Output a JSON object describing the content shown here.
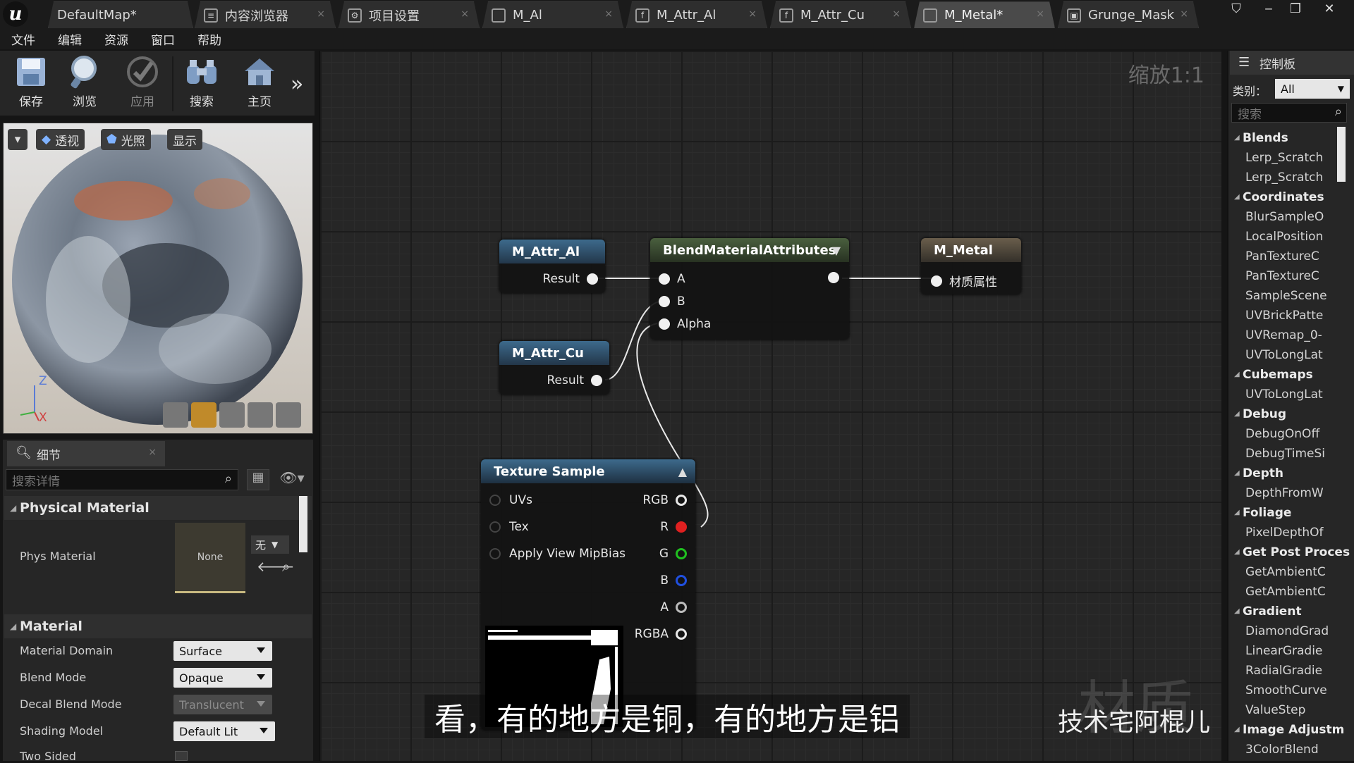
{
  "tabs": [
    {
      "label": "DefaultMap*",
      "icon": "map-icon"
    },
    {
      "label": "内容浏览器",
      "icon": "content-browser-icon"
    },
    {
      "label": "项目设置",
      "icon": "settings-icon"
    },
    {
      "label": "M_Al",
      "icon": "material-icon"
    },
    {
      "label": "M_Attr_Al",
      "icon": "material-function-icon"
    },
    {
      "label": "M_Attr_Cu",
      "icon": "material-function-icon"
    },
    {
      "label": "M_Metal*",
      "icon": "material-icon"
    },
    {
      "label": "Grunge_Mask",
      "icon": "texture-icon"
    }
  ],
  "menu": [
    "文件",
    "编辑",
    "资源",
    "窗口",
    "帮助"
  ],
  "toolbar": {
    "save": "保存",
    "browse": "浏览",
    "apply": "应用",
    "search": "搜索",
    "home": "主页"
  },
  "viewport": {
    "perspective": "透视",
    "lit": "光照",
    "show": "显示",
    "axis_z": "Z",
    "axis_x": "X"
  },
  "details": {
    "tab_label": "细节",
    "search_placeholder": "搜索详情",
    "physical_material": {
      "header": "Physical Material",
      "phys_label": "Phys Material",
      "thumb_text": "None",
      "dropdown_value": "无"
    },
    "material": {
      "header": "Material",
      "rows": [
        {
          "label": "Material Domain",
          "value": "Surface"
        },
        {
          "label": "Blend Mode",
          "value": "Opaque"
        },
        {
          "label": "Decal Blend Mode",
          "value": "Translucent"
        },
        {
          "label": "Shading Model",
          "value": "Default Lit"
        },
        {
          "label": "Two Sided",
          "value": ""
        }
      ]
    }
  },
  "graph": {
    "zoom": "缩放1:1",
    "nodes": {
      "attr_al": {
        "title": "M_Attr_Al",
        "output": "Result"
      },
      "attr_cu": {
        "title": "M_Attr_Cu",
        "output": "Result"
      },
      "blend": {
        "title": "BlendMaterialAttributes",
        "inputs": [
          "A",
          "B",
          "Alpha"
        ]
      },
      "metal": {
        "title": "M_Metal",
        "input": "材质属性"
      },
      "texture": {
        "title": "Texture Sample",
        "inputs": [
          "UVs",
          "Tex",
          "Apply View MipBias"
        ],
        "outputs": [
          "RGB",
          "R",
          "G",
          "B",
          "A",
          "RGBA"
        ]
      }
    },
    "pin_colors": {
      "R": "#e02020",
      "G": "#20c020",
      "B": "#2050e0",
      "default": "#e8e8e8"
    }
  },
  "subtitle": "看，有的地方是铜，有的地方是铝",
  "watermark": "技术宅阿棍儿",
  "palette": {
    "tab_label": "控制板",
    "category_label": "类别：",
    "category_value": "All",
    "search_placeholder": "搜索",
    "groups": [
      {
        "name": "Blends",
        "items": [
          "Lerp_Scratch",
          "Lerp_Scratch"
        ]
      },
      {
        "name": "Coordinates",
        "items": [
          "BlurSampleO",
          "LocalPosition",
          "PanTextureC",
          "PanTextureC",
          "SampleScene",
          "UVBrickPatte",
          "UVRemap_0-",
          "UVToLongLat"
        ]
      },
      {
        "name": "Cubemaps",
        "items": [
          "UVToLongLat"
        ]
      },
      {
        "name": "Debug",
        "items": [
          "DebugOnOff",
          "DebugTimeSi"
        ]
      },
      {
        "name": "Depth",
        "items": [
          "DepthFromW"
        ]
      },
      {
        "name": "Foliage",
        "items": [
          "PixelDepthOf"
        ]
      },
      {
        "name": "Get Post Proces",
        "items": [
          "GetAmbientC",
          "GetAmbientC"
        ]
      },
      {
        "name": "Gradient",
        "items": [
          "DiamondGrad",
          "LinearGradie",
          "RadialGradie",
          "SmoothCurve",
          "ValueStep"
        ]
      },
      {
        "name": "Image Adjustm",
        "items": [
          "3ColorBlend"
        ]
      }
    ]
  }
}
